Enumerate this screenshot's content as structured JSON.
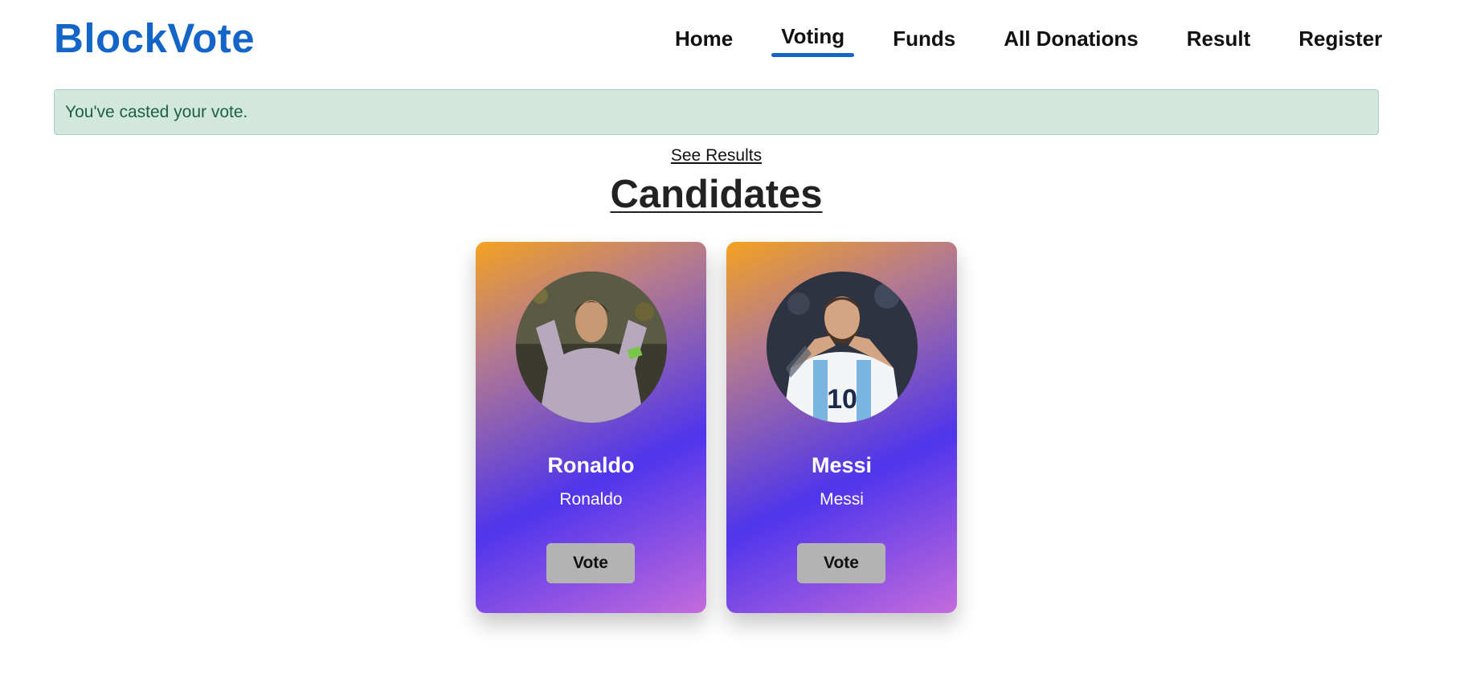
{
  "brand": "BlockVote",
  "nav": [
    {
      "label": "Home",
      "active": false
    },
    {
      "label": "Voting",
      "active": true
    },
    {
      "label": "Funds",
      "active": false
    },
    {
      "label": "All Donations",
      "active": false
    },
    {
      "label": "Result",
      "active": false
    },
    {
      "label": "Register",
      "active": false
    }
  ],
  "alert": "You've casted your vote.",
  "see_results": "See Results",
  "section_title": "Candidates",
  "candidates": [
    {
      "name": "Ronaldo",
      "subtitle": "Ronaldo",
      "vote_label": "Vote",
      "photo": "ronaldo-photo"
    },
    {
      "name": "Messi",
      "subtitle": "Messi",
      "vote_label": "Vote",
      "photo": "messi-photo"
    }
  ],
  "colors": {
    "brand": "#1366c8",
    "alert_bg": "#d2e7de",
    "alert_text": "#1c6243",
    "card_gradient": [
      "#f4a220",
      "#4f35ec",
      "#c46bdc"
    ],
    "vote_button": "#b3b3b3"
  }
}
